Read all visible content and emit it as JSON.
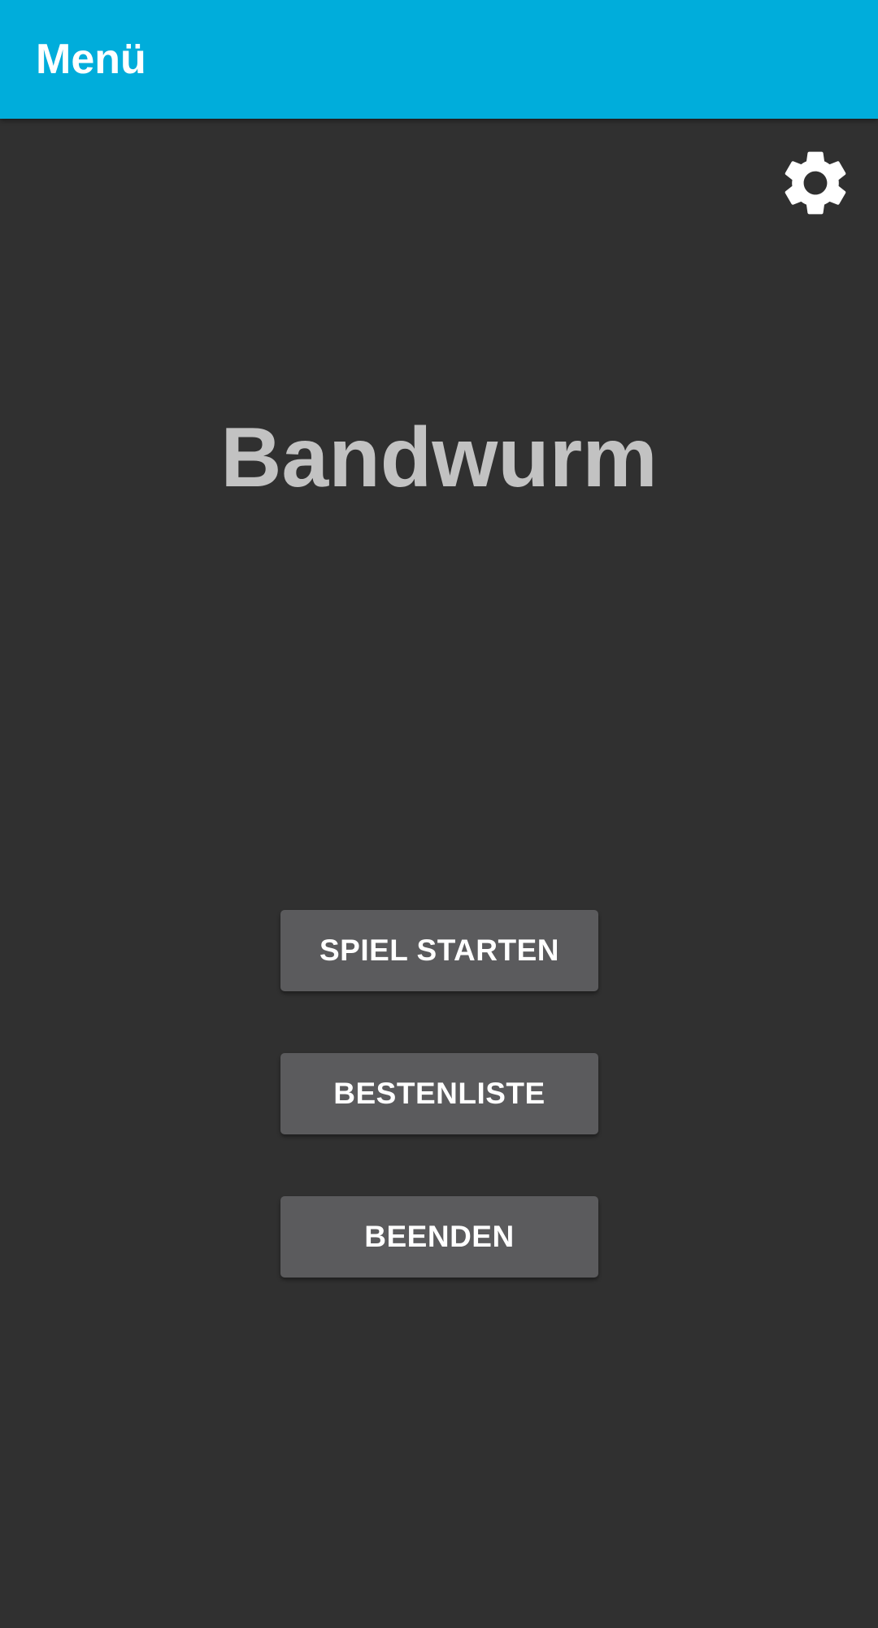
{
  "app_bar": {
    "title": "Menü",
    "background_color": "#00ADDB"
  },
  "settings": {
    "icon": "gear-icon"
  },
  "game_title": "Bandwurm",
  "menu": {
    "start_label": "SPIEL STARTEN",
    "highscore_label": "BESTENLISTE",
    "quit_label": "BEENDEN"
  },
  "colors": {
    "background": "#303030",
    "button": "#5B5B5D",
    "title_text": "#C2C2C2"
  }
}
